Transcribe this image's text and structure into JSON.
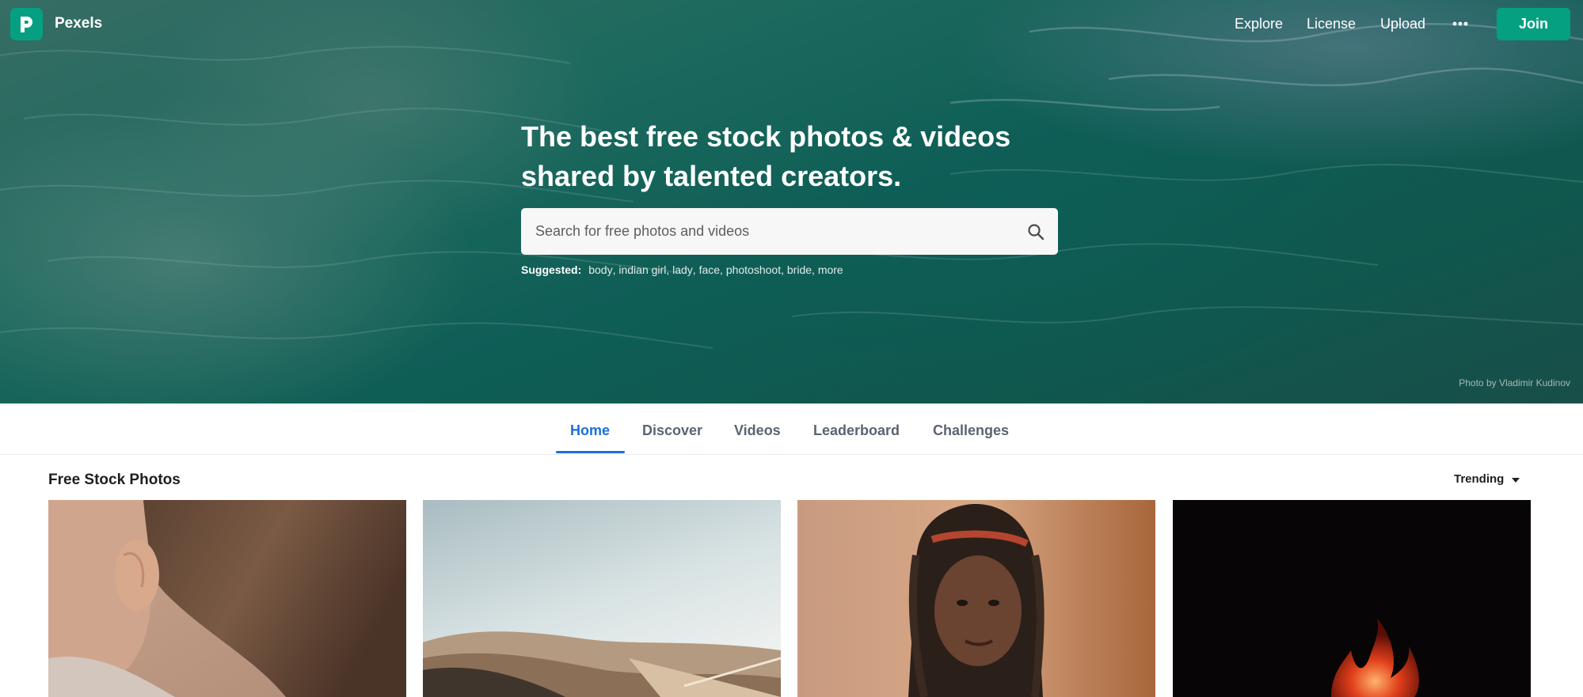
{
  "brand": {
    "name": "Pexels",
    "accent": "#05a081"
  },
  "nav": {
    "links": [
      "Explore",
      "License",
      "Upload"
    ],
    "more_icon": "ellipsis-icon",
    "join_label": "Join"
  },
  "hero": {
    "headline": "The best free stock photos & videos shared by talented creators.",
    "search_placeholder": "Search for free photos and videos",
    "search_icon": "search-icon",
    "suggested_label": "Suggested:",
    "suggested": [
      "body",
      "indian girl",
      "lady",
      "face",
      "photoshoot",
      "bride",
      "more"
    ],
    "photo_credit": "Photo by Vladimir Kudinov"
  },
  "tabs": {
    "items": [
      "Home",
      "Discover",
      "Videos",
      "Leaderboard",
      "Challenges"
    ],
    "active": "Home",
    "active_color": "#1a6fd8"
  },
  "gallery": {
    "title": "Free Stock Photos",
    "sort_label": "Trending",
    "sort_icon": "caret-down-icon"
  }
}
